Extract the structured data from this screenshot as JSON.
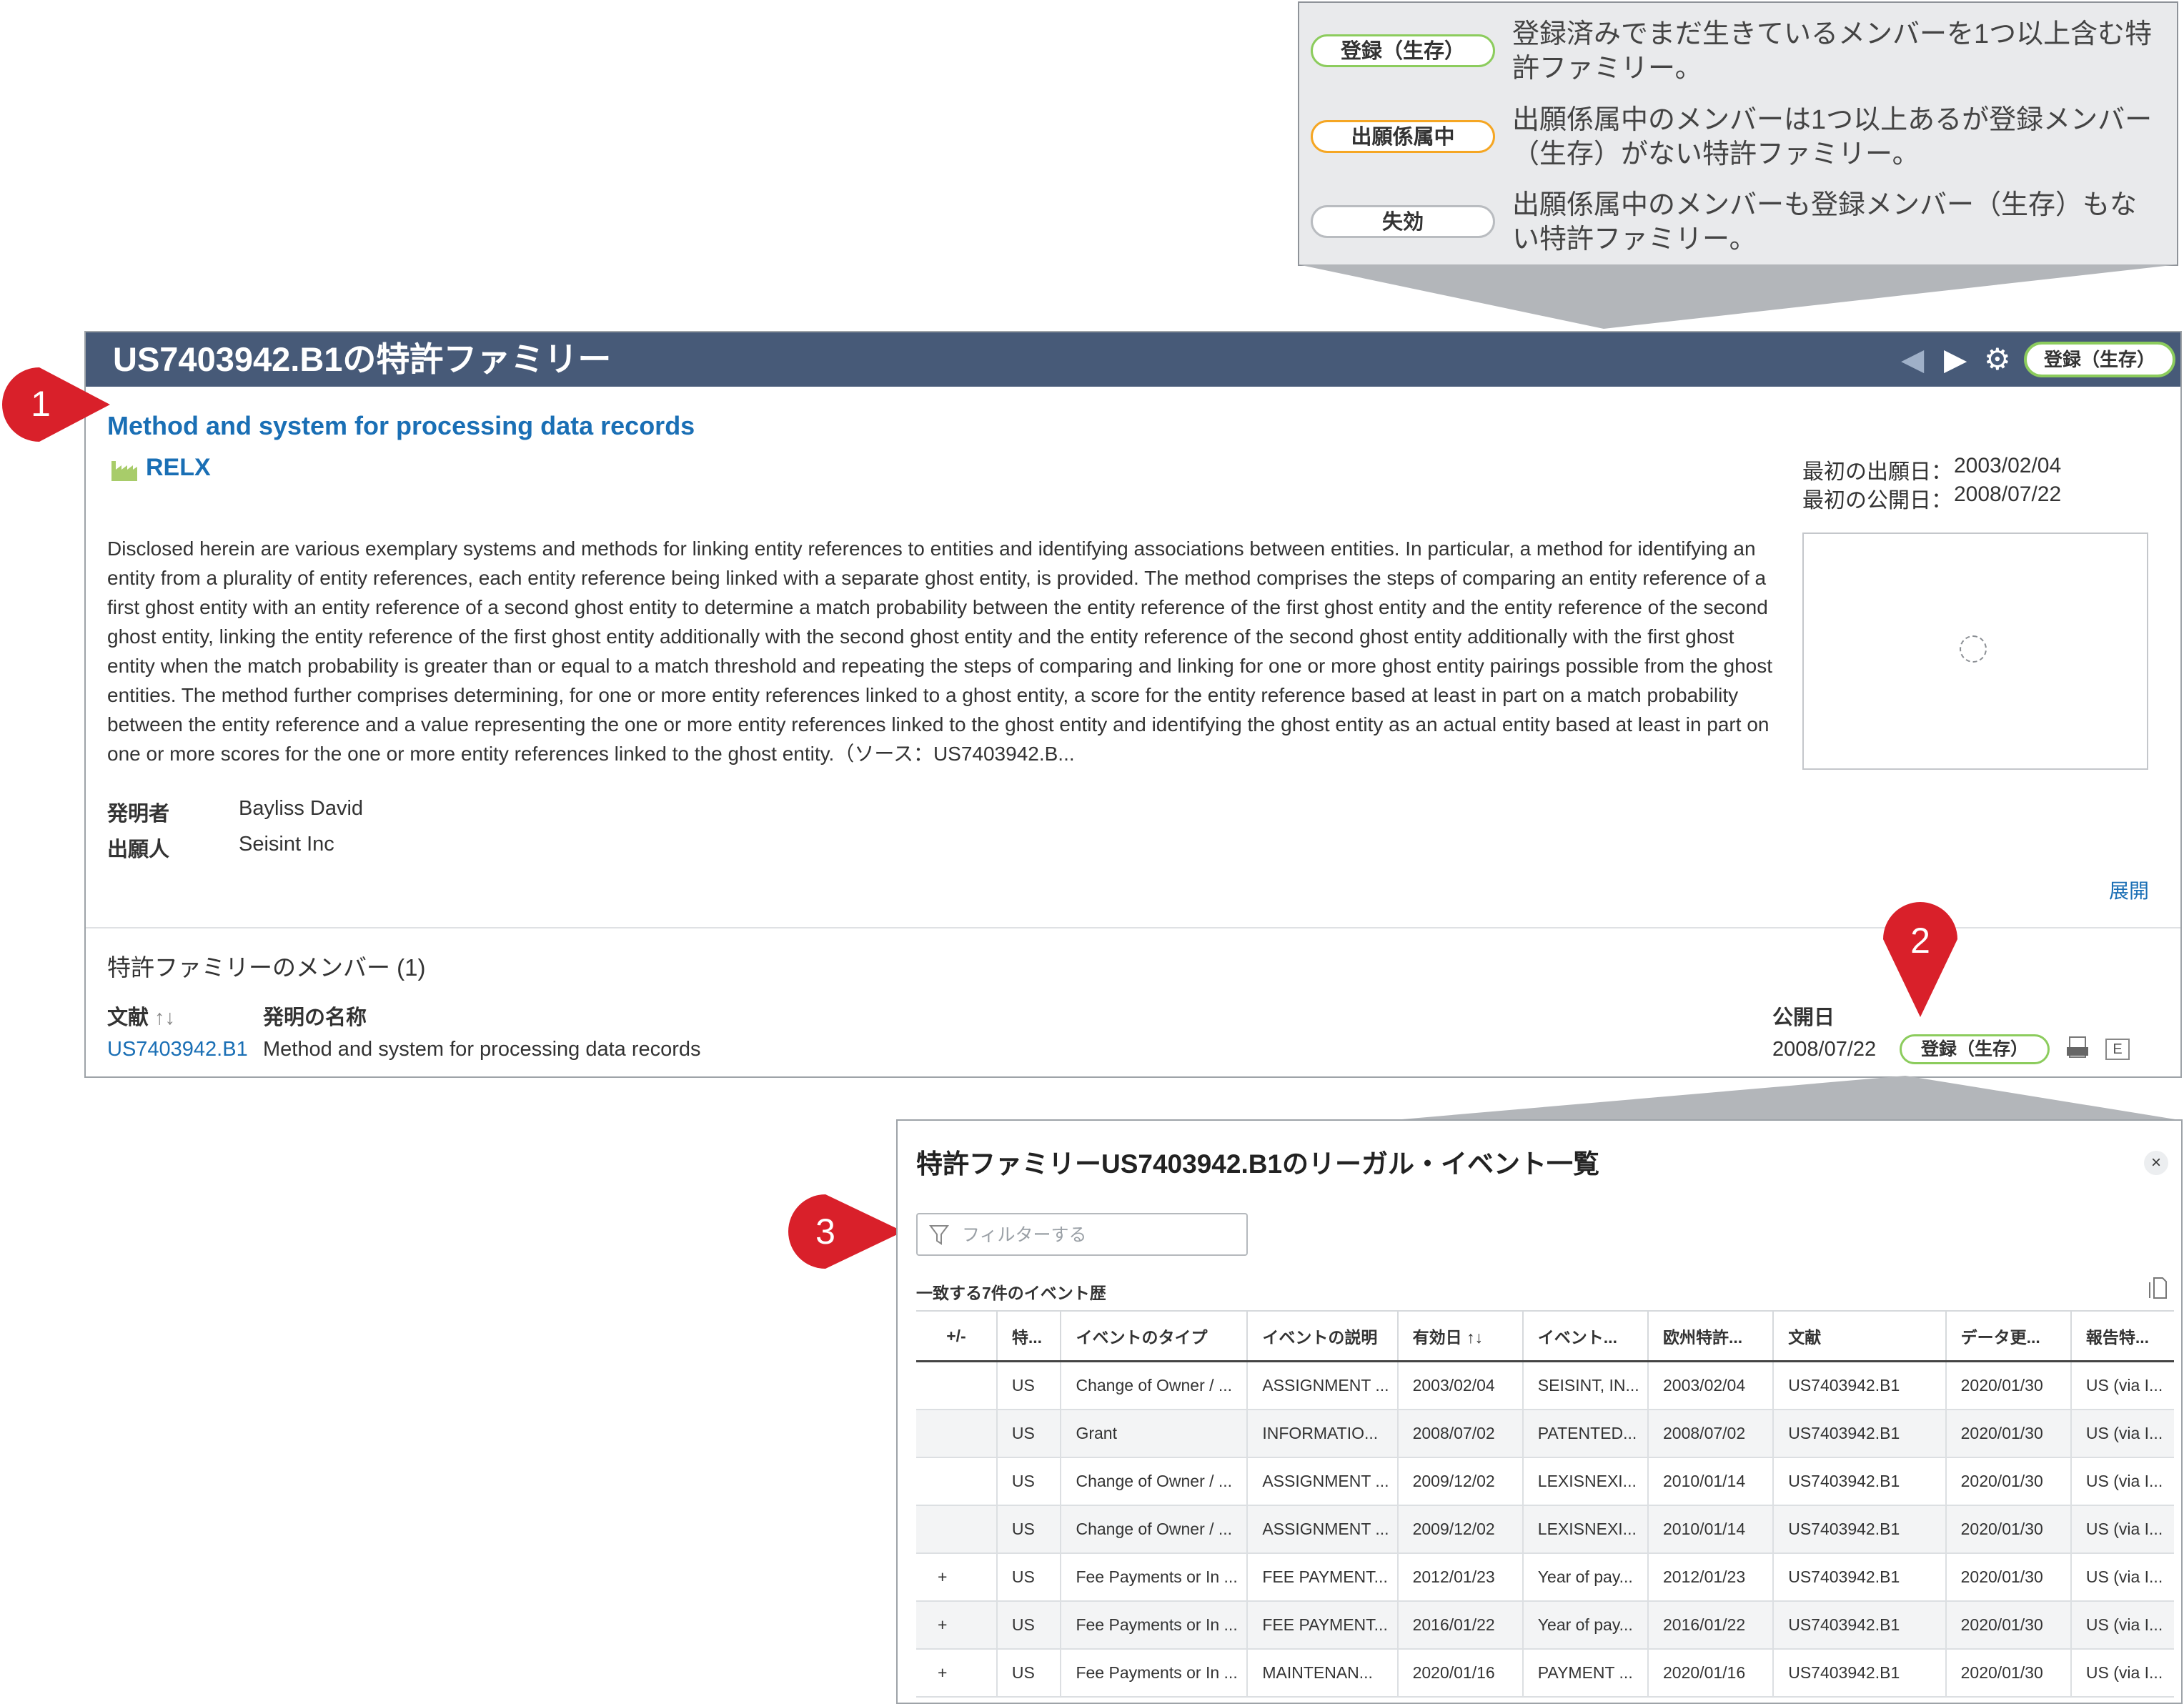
{
  "legend": [
    {
      "label": "登録（生存）",
      "color": "#8ccc5d",
      "desc": "登録済みでまだ生きているメンバーを1つ以上含む特許ファミリー。"
    },
    {
      "label": "出願係属中",
      "color": "#f5a623",
      "desc": "出願係属中のメンバーは1つ以上あるが登録メンバー（生存）がない特許ファミリー。"
    },
    {
      "label": "失効",
      "color": "#b9bcc0",
      "desc": "出願係属中のメンバーも登録メンバー（生存）もない特許ファミリー。"
    }
  ],
  "panel": {
    "title": "US7403942.B1の特許ファミリー",
    "status": "登録（生存）",
    "doc_title": "Method and system for processing data records",
    "assignee": "RELX",
    "dates": [
      {
        "label": "最初の出願日：",
        "value": "2003/02/04"
      },
      {
        "label": "最初の公開日：",
        "value": "2008/07/22"
      }
    ],
    "abstract": "Disclosed herein are various exemplary systems and methods for linking entity references to entities and identifying associations between entities. In particular, a method for identifying an entity from a plurality of entity references, each entity reference being linked with a separate ghost entity, is provided. The method comprises the steps of comparing an entity reference of a first ghost entity with an entity reference of a second ghost entity to determine a match probability between the entity reference of the first ghost entity and the entity reference of the second ghost entity, linking the entity reference of the first ghost entity additionally with the second ghost entity and the entity reference of the second ghost entity additionally with the first ghost entity when the match probability is greater than or equal to a match threshold and repeating the steps of comparing and linking for one or more ghost entity pairings possible from the ghost entities. The method further comprises determining, for one or more entity references linked to a ghost entity, a score for the entity reference based at least in part on a match probability between the entity reference and a value representing the one or more entity references linked to the ghost entity and identifying the ghost entity as an actual entity based at least in part on one or more scores for the one or more entity references linked to the ghost entity.（ソース：US7403942.B...",
    "inventor_label": "発明者",
    "inventor": "Bayliss David",
    "applicant_label": "出願人",
    "applicant": "Seisint Inc",
    "expand": "展開",
    "members_title": "特許ファミリーのメンバー (1)",
    "columns": {
      "doc": "文献",
      "doc_sort": "↑↓",
      "title": "発明の名称",
      "pubdate": "公開日"
    },
    "row": {
      "doc": "US7403942.B1",
      "title": "Method and system for processing data records",
      "pubdate": "2008/07/22",
      "status": "登録（生存）",
      "e_label": "E"
    }
  },
  "markers": [
    "1",
    "2",
    "3"
  ],
  "dialog": {
    "title": "特許ファミリーUS7403942.B1のリーガル・イベント一覧",
    "close": "×",
    "filter_placeholder": "フィルターする",
    "match_count": "一致する7件のイベント歴",
    "headers": [
      "+/-",
      "特...",
      "イベントのタイプ",
      "イベントの説明",
      "有効日 ↑↓",
      "イベント...",
      "欧州特許...",
      "文献",
      "データ更...",
      "報告特..."
    ],
    "rows": [
      [
        "",
        "US",
        "Change of Owner / ...",
        "ASSIGNMENT ...",
        "2003/02/04",
        "SEISINT, IN...",
        "2003/02/04",
        "US7403942.B1",
        "2020/01/30",
        "US (via I..."
      ],
      [
        "",
        "US",
        "Grant",
        "INFORMATIO...",
        "2008/07/02",
        "PATENTED...",
        "2008/07/02",
        "US7403942.B1",
        "2020/01/30",
        "US (via I..."
      ],
      [
        "",
        "US",
        "Change of Owner / ...",
        "ASSIGNMENT ...",
        "2009/12/02",
        "LEXISNEXI...",
        "2010/01/14",
        "US7403942.B1",
        "2020/01/30",
        "US (via I..."
      ],
      [
        "",
        "US",
        "Change of Owner / ...",
        "ASSIGNMENT ...",
        "2009/12/02",
        "LEXISNEXI...",
        "2010/01/14",
        "US7403942.B1",
        "2020/01/30",
        "US (via I..."
      ],
      [
        "+",
        "US",
        "Fee Payments or In ...",
        "FEE PAYMENT...",
        "2012/01/23",
        "Year of pay...",
        "2012/01/23",
        "US7403942.B1",
        "2020/01/30",
        "US (via I..."
      ],
      [
        "+",
        "US",
        "Fee Payments or In ...",
        "FEE PAYMENT...",
        "2016/01/22",
        "Year of pay...",
        "2016/01/22",
        "US7403942.B1",
        "2020/01/30",
        "US (via I..."
      ],
      [
        "+",
        "US",
        "Fee Payments or In ...",
        "MAINTENAN...",
        "2020/01/16",
        "PAYMENT ...",
        "2020/01/16",
        "US7403942.B1",
        "2020/01/30",
        "US (via I..."
      ]
    ]
  }
}
